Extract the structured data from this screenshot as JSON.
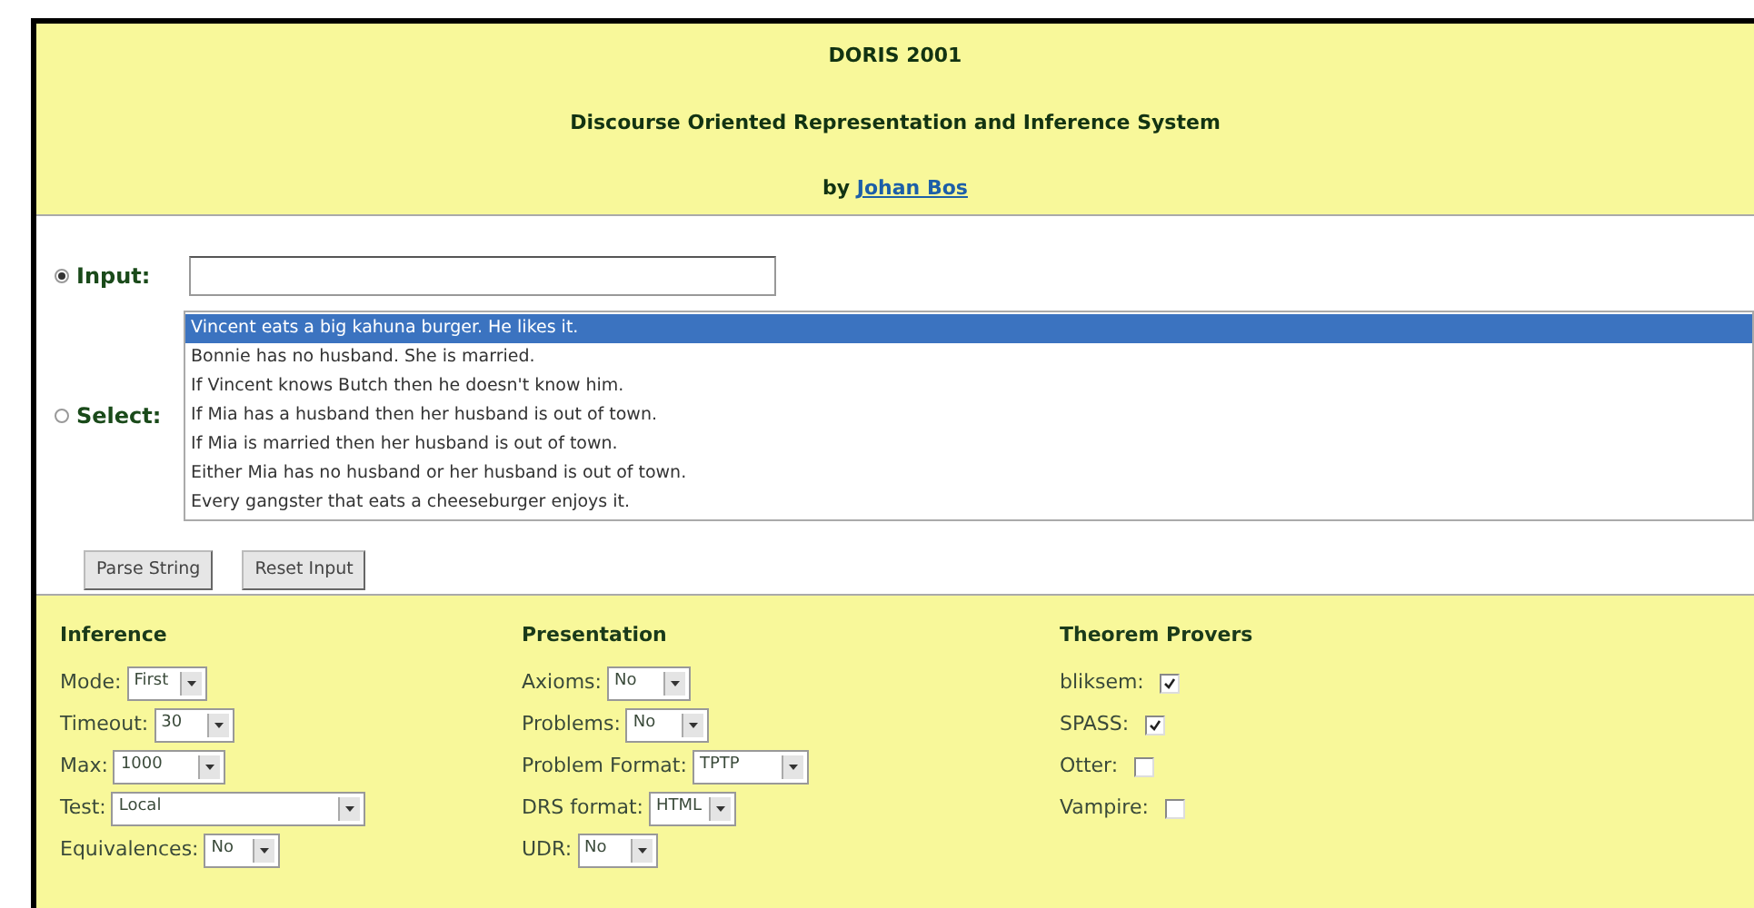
{
  "header": {
    "title": "DORIS 2001",
    "subtitle": "Discourse Oriented Representation and Inference System",
    "byline": "by",
    "author_link": "Johan Bos"
  },
  "input_mode": {
    "input": {
      "label": "Input:",
      "selected": true
    },
    "select": {
      "label": "Select:",
      "selected": false,
      "options": [
        {
          "text": "Vincent eats a big kahuna burger. He likes it.",
          "selected": true
        },
        {
          "text": "Bonnie has no husband. She is married.",
          "selected": false
        },
        {
          "text": "If Vincent knows Butch then he doesn't know him.",
          "selected": false
        },
        {
          "text": "If Mia has a husband then her husband is out of town.",
          "selected": false
        },
        {
          "text": "If Mia is married then her husband is out of town.",
          "selected": false
        },
        {
          "text": "Either Mia has no husband or her husband is out of town.",
          "selected": false
        },
        {
          "text": "Every gangster that eats a cheeseburger enjoys it.",
          "selected": false
        }
      ]
    }
  },
  "buttons": [
    "Parse String",
    "Reset Input"
  ],
  "settings": [
    {
      "heading": "Inference",
      "fields": [
        {
          "kind": "dropdown",
          "label": "Mode:",
          "value": "First"
        },
        {
          "kind": "dropdown",
          "label": "Timeout:",
          "value": "30"
        },
        {
          "kind": "dropdown",
          "label": "Max:",
          "value": "1000"
        },
        {
          "kind": "dropdown",
          "label": "Test:",
          "value": "Local"
        },
        {
          "kind": "dropdown",
          "label": "Equivalences:",
          "value": "No"
        }
      ]
    },
    {
      "heading": "Presentation",
      "fields": [
        {
          "kind": "dropdown",
          "label": "Axioms:",
          "value": "No"
        },
        {
          "kind": "dropdown",
          "label": "Problems:",
          "value": "No"
        },
        {
          "kind": "dropdown",
          "label": "Problem Format:",
          "value": "TPTP"
        },
        {
          "kind": "dropdown",
          "label": "DRS format:",
          "value": "HTML"
        },
        {
          "kind": "dropdown",
          "label": "UDR:",
          "value": "No"
        }
      ]
    },
    {
      "heading": "Theorem Provers",
      "fields": [
        {
          "kind": "checkbox",
          "label": "bliksem:",
          "checked": true
        },
        {
          "kind": "checkbox",
          "label": "SPASS:",
          "checked": true
        },
        {
          "kind": "checkbox",
          "label": "Otter:",
          "checked": false
        },
        {
          "kind": "checkbox",
          "label": "Vampire:",
          "checked": false
        }
      ]
    }
  ]
}
